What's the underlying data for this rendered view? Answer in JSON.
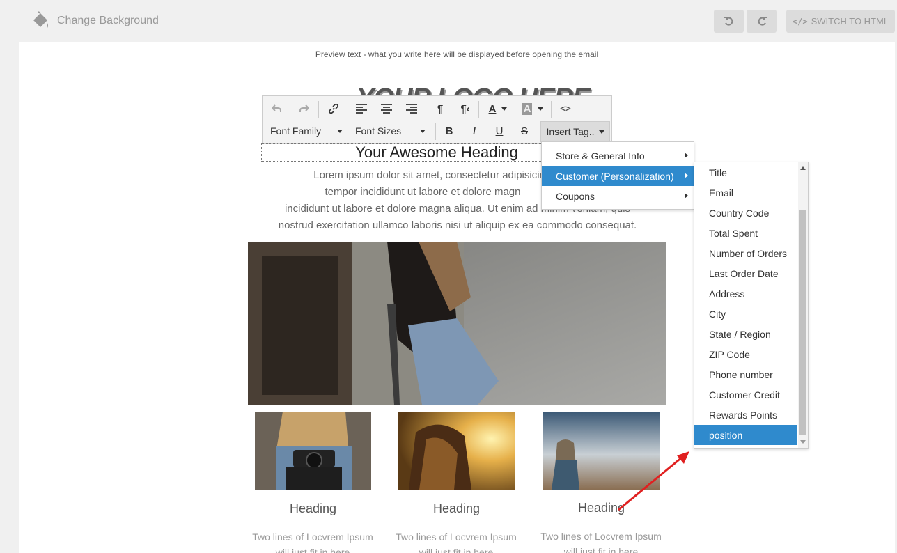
{
  "topbar": {
    "change_background": "Change Background",
    "switch_html": "SWITCH TO HTML",
    "undo_icon": "undo-icon",
    "redo_icon": "redo-icon"
  },
  "email": {
    "preview_text": "Preview text - what you write here will be displayed before opening the email",
    "logo_text": "YOUR LOGO HERE",
    "heading": "Your Awesome Heading",
    "lorem_lines": [
      "Lorem ipsum dolor sit amet, consectetur adipisicing e",
      "tempor incididunt ut labore et dolore magn",
      "incididunt ut labore et dolore magna aliqua. Ut enim ad minim veniam, quis",
      "nostrud exercitation ullamco laboris nisi ut aliquip ex ea commodo consequat."
    ],
    "columns": [
      {
        "heading": "Heading",
        "text_line1": "Two lines of Locvrem Ipsum",
        "text_line2": "will just fit in here"
      },
      {
        "heading": "Heading",
        "text_line1": "Two lines of Locvrem Ipsum",
        "text_line2": "will just fit in here"
      },
      {
        "heading": "Heading",
        "text_line1": "Two lines of Locvrem Ipsum",
        "text_line2": "will just fit in here"
      }
    ]
  },
  "toolbar": {
    "font_family": "Font Family",
    "font_sizes": "Font Sizes",
    "insert_tag": "Insert Tag..",
    "bold": "B",
    "italic": "I",
    "underline": "U",
    "strike": "S",
    "text_color": "A",
    "bg_color": "A",
    "code": "<>"
  },
  "insert_menu": {
    "items": [
      {
        "label": "Store & General Info"
      },
      {
        "label": "Customer (Personalization)"
      },
      {
        "label": "Coupons"
      }
    ],
    "active_index": 1
  },
  "customer_submenu": {
    "items": [
      {
        "label": "Title"
      },
      {
        "label": "Email"
      },
      {
        "label": "Country Code"
      },
      {
        "label": "Total Spent"
      },
      {
        "label": "Number of Orders"
      },
      {
        "label": "Last Order Date"
      },
      {
        "label": "Address"
      },
      {
        "label": "City"
      },
      {
        "label": "State / Region"
      },
      {
        "label": "ZIP Code"
      },
      {
        "label": "Phone number"
      },
      {
        "label": "Customer Credit"
      },
      {
        "label": "Rewards Points"
      },
      {
        "label": "position"
      }
    ],
    "active_index": 13
  },
  "colors": {
    "accent": "#2f8acd",
    "annotation_arrow": "#e02020"
  }
}
